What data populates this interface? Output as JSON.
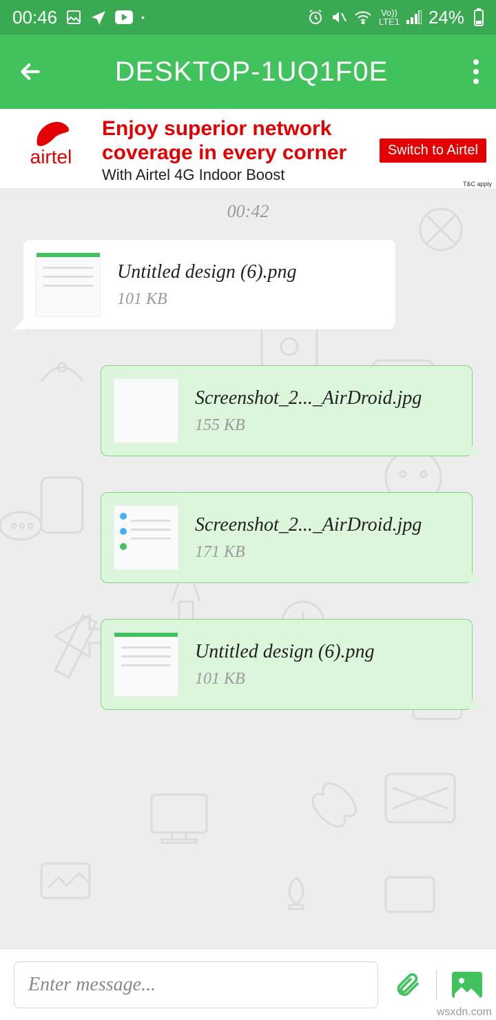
{
  "status": {
    "time": "00:46",
    "battery": "24%"
  },
  "header": {
    "title": "DESKTOP-1UQ1F0E"
  },
  "ad": {
    "brand": "airtel",
    "headline": "Enjoy superior network coverage in every corner",
    "subline": "With Airtel 4G Indoor Boost",
    "cta": "Switch to Airtel",
    "tac": "T&C apply"
  },
  "chat": {
    "timestamp": "00:42",
    "messages": [
      {
        "side": "incoming",
        "filename": "Untitled design (6).png",
        "size": "101 KB",
        "thumb": "doc"
      },
      {
        "side": "outgoing",
        "filename": "Screenshot_2..._AirDroid.jpg",
        "size": "155 KB",
        "thumb": "plain"
      },
      {
        "side": "outgoing",
        "filename": "Screenshot_2..._AirDroid.jpg",
        "size": "171 KB",
        "thumb": "dots"
      },
      {
        "side": "outgoing",
        "filename": "Untitled design (6).png",
        "size": "101 KB",
        "thumb": "doc"
      }
    ]
  },
  "input": {
    "placeholder": "Enter message..."
  },
  "watermark": "wsxdn.com"
}
